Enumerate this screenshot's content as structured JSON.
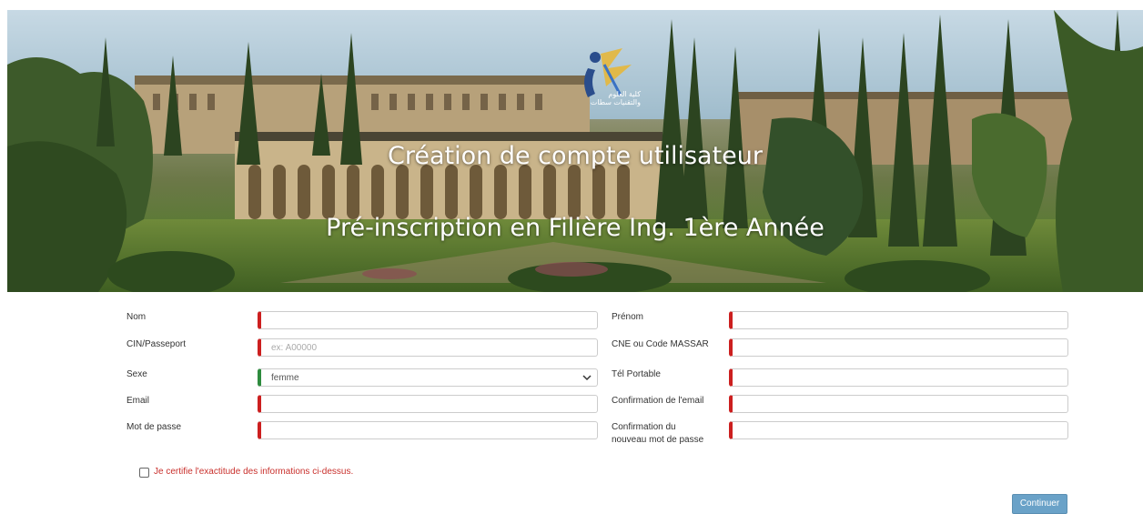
{
  "banner": {
    "title": "Création de compte utilisateur",
    "subtitle": "Pré-inscription en Filière Ing. 1ère Année",
    "logo_text": [
      "كلية العلوم",
      "والتقنيات سطات"
    ]
  },
  "form": {
    "nom_label": "Nom",
    "prenom_label": "Prénom",
    "cin_label": "CIN/Passeport",
    "cin_placeholder": "ex: A00000",
    "cne_label": "CNE ou Code MASSAR",
    "sexe_label": "Sexe",
    "sexe_value": "femme",
    "tel_label": "Tél Portable",
    "email_label": "Email",
    "email_confirm_label": "Confirmation de l'email",
    "password_label": "Mot de passe",
    "password_confirm_label_1": "Confirmation du",
    "password_confirm_label_2": "nouveau mot de passe",
    "certify_label": "Je certifie l'exactitude des informations ci-dessus.",
    "submit_label": "Continuer"
  },
  "colors": {
    "required_marker": "#cc1f1f",
    "valid_marker": "#2e8b3e",
    "button": "#6aa2c8",
    "certify_text": "#c9302c"
  }
}
